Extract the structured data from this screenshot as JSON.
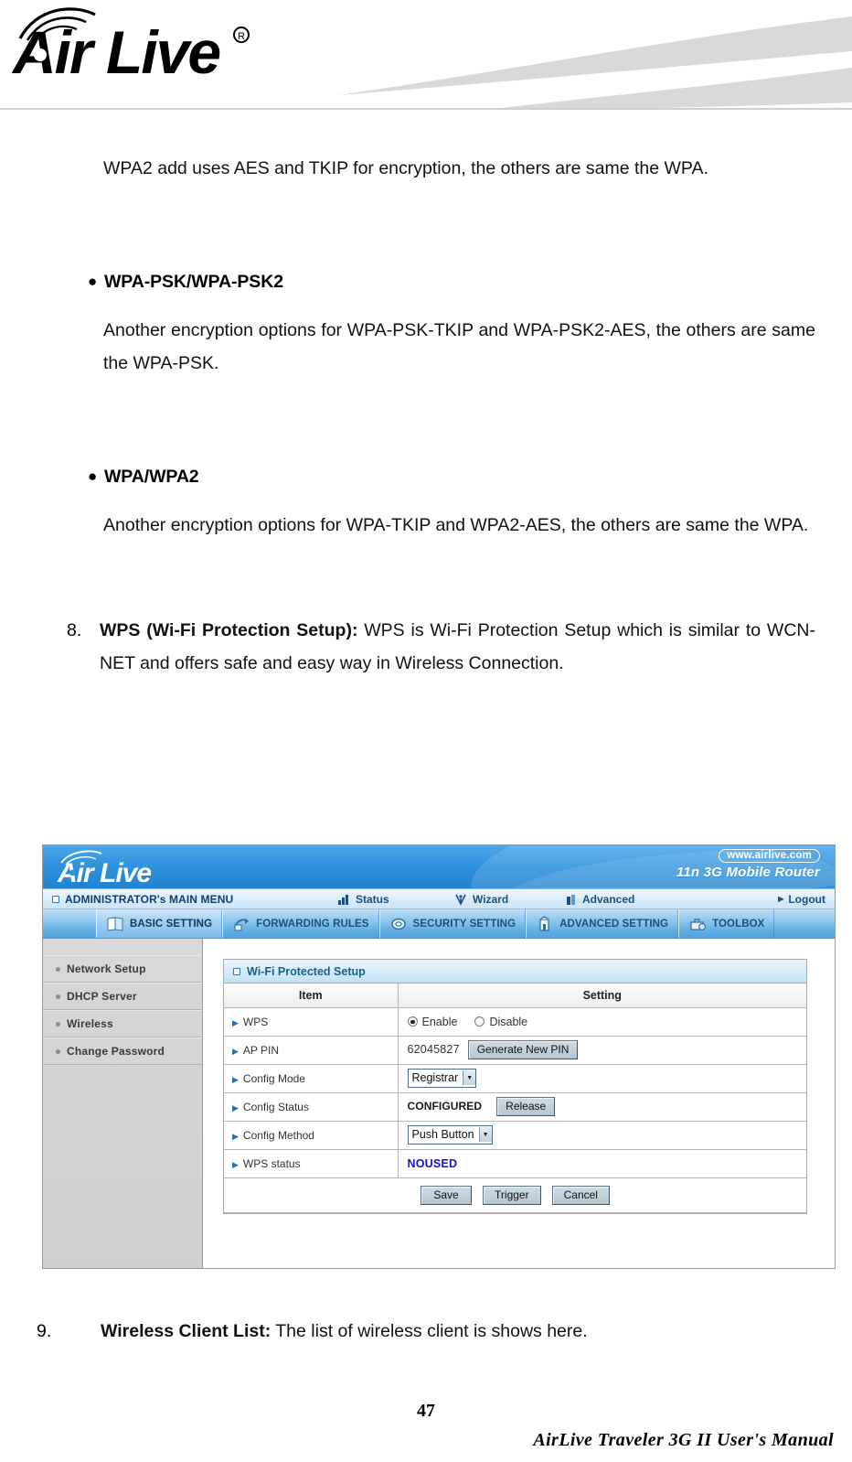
{
  "page_header": {
    "brand": "AirLive",
    "brand_mark": "registered-trademark"
  },
  "body": {
    "intro_paragraph": "WPA2 add uses AES and TKIP for encryption, the others are same the WPA.",
    "bullets": [
      {
        "label": "WPA-PSK/WPA-PSK2",
        "paragraph": "Another encryption options for WPA-PSK-TKIP and WPA-PSK2-AES, the others are same the WPA-PSK."
      },
      {
        "label": "WPA/WPA2",
        "paragraph": "Another encryption options for WPA-TKIP and WPA2-AES, the others are same the WPA."
      }
    ],
    "numbered_items": [
      {
        "number": "8.",
        "bold_lead": "WPS (Wi-Fi Protection Setup):",
        "text": " WPS is Wi-Fi Protection Setup which is similar to WCN-NET and offers safe and easy way in Wireless Connection."
      },
      {
        "number": "9.",
        "bold_lead": "Wireless Client List:",
        "text": " The list of wireless client is shows here."
      }
    ]
  },
  "router_ui": {
    "banner": {
      "logo_text": "AirLive",
      "url_badge": "www.airlive.com",
      "model": "11n 3G Mobile Router"
    },
    "admin_bar": {
      "title": "ADMINISTRATOR's MAIN MENU",
      "items": [
        {
          "label": "Status",
          "icon": "signal-bars-icon"
        },
        {
          "label": "Wizard",
          "icon": "wand-icon"
        },
        {
          "label": "Advanced",
          "icon": "tower-icon"
        }
      ],
      "logout": "Logout"
    },
    "tabs": [
      {
        "label": "BASIC SETTING",
        "icon": "book-icon",
        "active": true
      },
      {
        "label": "FORWARDING RULES",
        "icon": "arrow-pages-icon",
        "active": false
      },
      {
        "label": "SECURITY SETTING",
        "icon": "shield-oval-icon",
        "active": false
      },
      {
        "label": "ADVANCED SETTING",
        "icon": "building-icon",
        "active": false
      },
      {
        "label": "TOOLBOX",
        "icon": "toolbox-icon",
        "active": false
      }
    ],
    "sidebar": {
      "items": [
        {
          "label": "Network Setup"
        },
        {
          "label": "DHCP Server"
        },
        {
          "label": "Wireless"
        },
        {
          "label": "Change Password"
        }
      ]
    },
    "panel": {
      "title": "Wi-Fi Protected Setup",
      "columns": [
        "Item",
        "Setting"
      ],
      "rows": [
        {
          "item": "WPS",
          "control": "radio",
          "options": [
            {
              "label": "Enable",
              "selected": true
            },
            {
              "label": "Disable",
              "selected": false
            }
          ]
        },
        {
          "item": "AP PIN",
          "control": "text-with-button",
          "value": "62045827",
          "button": "Generate New PIN"
        },
        {
          "item": "Config Mode",
          "control": "select",
          "value": "Registrar"
        },
        {
          "item": "Config Status",
          "control": "status-with-button",
          "value": "CONFIGURED",
          "button": "Release"
        },
        {
          "item": "Config Method",
          "control": "select",
          "value": "Push Button"
        },
        {
          "item": "WPS status",
          "control": "status-text",
          "value": "NOUSED",
          "value_color": "#1414d8"
        }
      ],
      "actions": [
        "Save",
        "Trigger",
        "Cancel"
      ]
    }
  },
  "footer": {
    "page_number": "47",
    "manual_title": "AirLive  Traveler  3G  II  User's  Manual"
  }
}
